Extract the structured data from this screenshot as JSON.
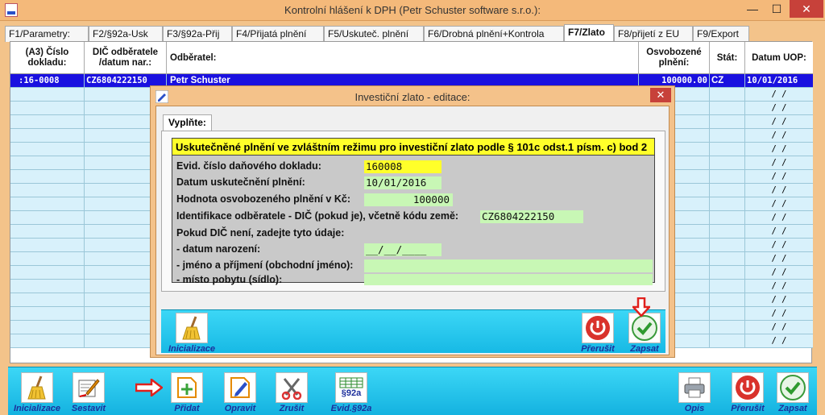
{
  "window": {
    "title": "Kontrolní hlášení k DPH (Petr Schuster software s.r.o.):",
    "minimize": "—",
    "maximize": "☐",
    "close": "✕"
  },
  "tabs": [
    {
      "label": "F1/Parametry:"
    },
    {
      "label": "F2/§92a-Usk"
    },
    {
      "label": "F3/§92a-Přij"
    },
    {
      "label": "F4/Přijatá plnění"
    },
    {
      "label": "F5/Uskuteč. plnění"
    },
    {
      "label": "F6/Drobná plnění+Kontrola"
    },
    {
      "label": "F7/Zlato"
    },
    {
      "label": "F8/přijetí z EU"
    },
    {
      "label": "F9/Export"
    }
  ],
  "grid": {
    "headers": {
      "doc": "(A3) Číslo dokladu:",
      "dic": "DIČ odběratele /datum nar.:",
      "buyer": "Odběratel:",
      "amount": "Osvobozené plnění:",
      "state": "Stát:",
      "date": "Datum UOP:"
    },
    "selected_row": {
      "doc": ":16-0008",
      "dic": "CZ6804222150",
      "buyer": "Petr Schuster",
      "amount": "100000.00",
      "state": "CZ",
      "date": "10/01/2016"
    },
    "empty_date": "/  /"
  },
  "dialog": {
    "title": "Investiční zlato - editace:",
    "close": "✕",
    "tab": "Vyplňte:",
    "heading": "Uskutečněné plnění ve zvláštním režimu pro investiční zlato podle § 101c odst.1 písm. c) bod 2",
    "fields": {
      "doc_no_label": "Evid. číslo daňového dokladu:",
      "doc_no_value": "160008",
      "date_label": "Datum uskutečnění plnění:",
      "date_value": "10/01/2016",
      "amount_label": "Hodnota osvobozeného plnění v Kč:",
      "amount_value": "100000",
      "dic_label": "Identifikace odběratele - DIČ (pokud je), včetně kódu země:",
      "dic_value": "CZ6804222150",
      "note": "Pokud DIČ není, zadejte tyto údaje:",
      "birth_label": "- datum narození:",
      "birth_value": "__/__/____",
      "name_label": "- jméno a příjmení (obchodní jméno):",
      "name_value": "",
      "address_label": "- místo pobytu (sídlo):",
      "address_value": ""
    },
    "buttons": {
      "init": "Inicializace",
      "cancel": "Přerušit",
      "save": "Zapsat"
    }
  },
  "toolbar": {
    "init": "Inicializace",
    "compose": "Sestavit",
    "add": "Přidat",
    "edit": "Opravit",
    "delete": "Zrušit",
    "evid_icon": "§92a",
    "evid": "Evid.§92a",
    "print": "Opis",
    "cancel": "Přerušit",
    "save": "Zapsat"
  },
  "colors": {
    "selection": "#1a10e0",
    "row": "#d8f1fb",
    "input": "#c8f7b5",
    "highlight": "#ffff2a",
    "toolbar": "#3cd7f6"
  }
}
